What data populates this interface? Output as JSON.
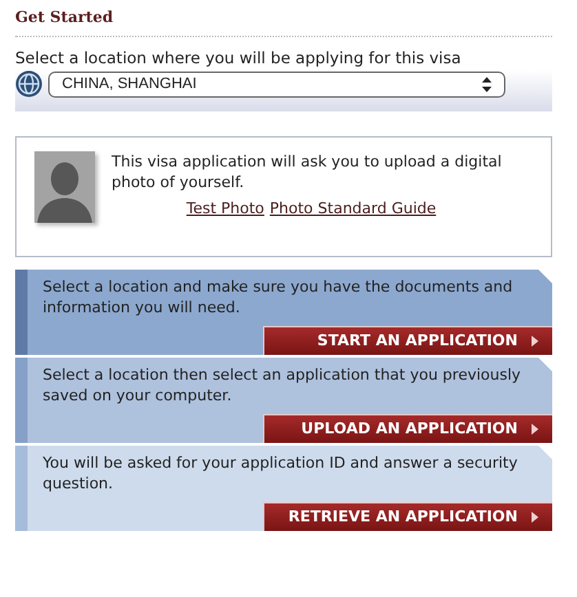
{
  "heading": "Get Started",
  "location": {
    "label": "Select a location where you will be applying for this visa",
    "value": "CHINA, SHANGHAI"
  },
  "photo_notice": {
    "text": "This visa application will ask you to upload a digital photo of yourself.",
    "links": [
      "Test Photo",
      "Photo Standard Guide"
    ]
  },
  "actions": [
    {
      "description": "Select a location and make sure you have the documents and information you will need.",
      "button": "START AN APPLICATION",
      "color": "#8ca8cf"
    },
    {
      "description": "Select a location then select an application that you previously saved on your computer.",
      "button": "UPLOAD AN APPLICATION",
      "color": "#aec1dd"
    },
    {
      "description": "You will be asked for your application ID and answer a security question.",
      "button": "RETRIEVE AN APPLICATION",
      "color": "#cddbec"
    }
  ]
}
